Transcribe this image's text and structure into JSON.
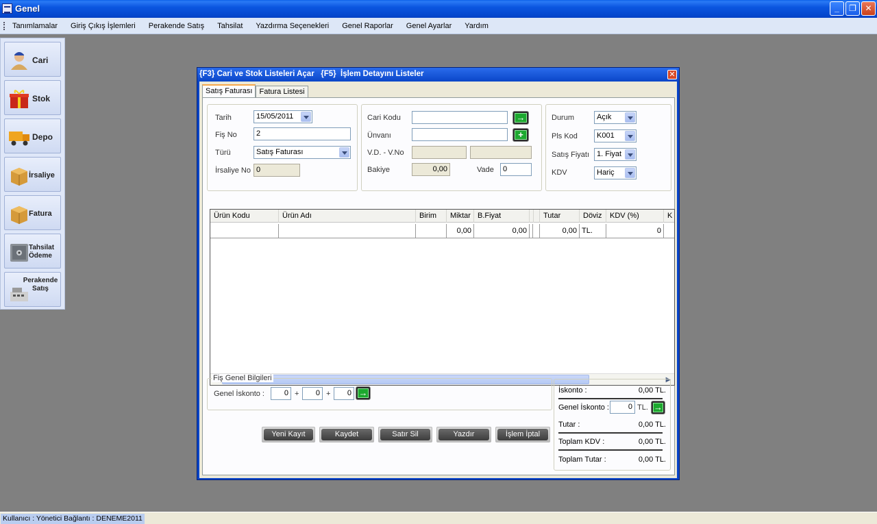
{
  "window": {
    "title": "Genel"
  },
  "menu": [
    "Tanımlamalar",
    "Giriş Çıkış İşlemleri",
    "Perakende Satış",
    "Tahsilat",
    "Yazdırma Seçenekleri",
    "Genel Raporlar",
    "Genel Ayarlar",
    "Yardım"
  ],
  "sidebar": {
    "items": [
      {
        "label": "Cari",
        "icon": "person-icon"
      },
      {
        "label": "Stok",
        "icon": "gift-box-icon"
      },
      {
        "label": "Depo",
        "icon": "truck-icon"
      },
      {
        "label": "İrsaliye",
        "icon": "box-icon"
      },
      {
        "label": "Fatura",
        "icon": "box-icon"
      },
      {
        "label": "Tahsilat Ödeme",
        "icon": "safe-icon"
      },
      {
        "label": "Perakende Satış",
        "icon": "cash-register-icon"
      }
    ]
  },
  "dialog": {
    "title": "{F3} Cari ve Stok Listeleri Açar   {F5}  İşlem Detayını Listeler",
    "tabs": [
      "Satış Faturası",
      "Fatura Listesi"
    ],
    "left": {
      "tarih_label": "Tarih",
      "tarih_value": "15/05/2011",
      "fisno_label": "Fiş No",
      "fisno_value": "2",
      "turu_label": "Türü",
      "turu_value": "Satış Faturası",
      "irsaliye_label": "İrsaliye No",
      "irsaliye_value": "0"
    },
    "middle": {
      "carikodu_label": "Cari Kodu",
      "carikodu_value": "",
      "unvani_label": "Ünvanı",
      "unvani_value": "",
      "vd_label": "V.D. - V.No",
      "bakiye_label": "Bakiye",
      "bakiye_value": "0,00",
      "vade_label": "Vade",
      "vade_value": "0"
    },
    "right": {
      "durum_label": "Durum",
      "durum_value": "Açık",
      "plskod_label": "Pls Kod",
      "plskod_value": "K001",
      "satisfiyati_label": "Satış Fiyatı",
      "satisfiyati_value": "1. Fiyat",
      "kdv_label": "KDV",
      "kdv_value": "Hariç"
    },
    "grid": {
      "columns": [
        "Ürün Kodu",
        "Ürün Adı",
        "Birim",
        "Miktar",
        "B.Fiyat",
        "",
        "",
        "Tutar",
        "Döviz",
        "KDV (%)",
        "K"
      ],
      "row": [
        "",
        "",
        "",
        "0,00",
        "0,00",
        "",
        "",
        "0,00",
        "TL.",
        "0",
        ""
      ]
    },
    "fis": {
      "legend": "Fiş Genel Bilgileri",
      "iskonto_label": "Genel İskonto :",
      "v1": "0",
      "v2": "0",
      "v3": "0",
      "plus": "+"
    },
    "buttons": [
      "Yeni Kayıt",
      "Kaydet",
      "Satır Sil",
      "Yazdır",
      "İşlem İptal"
    ],
    "totals": {
      "iskonto_label": "İskonto :",
      "iskonto_value": "0,00 TL.",
      "genel_iskonto_label": "Genel İskonto :",
      "genel_iskonto_value": "0",
      "genel_iskonto_unit": "TL.",
      "tutar_label": "Tutar :",
      "tutar_value": "0,00 TL.",
      "toplam_kdv_label": "Toplam KDV :",
      "toplam_kdv_value": "0,00 TL.",
      "toplam_tutar_label": "Toplam Tutar :",
      "toplam_tutar_value": "0,00 TL."
    }
  },
  "status": {
    "text": "Kullanıcı : Yönetici  Bağlantı : DENEME2011"
  }
}
